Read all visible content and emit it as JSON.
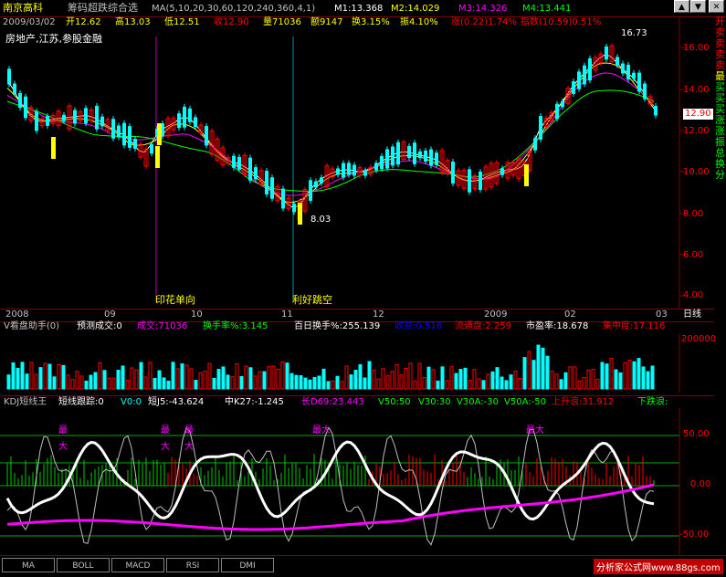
{
  "header": {
    "stock_name": "南京高科",
    "indicator_name": "筹码超跌综合选",
    "ma_params": "MA(5,10,20,30,60,120,240,360,4,1)",
    "m1": "M1:13.368",
    "m2": "M2:14.029",
    "m3": "M3:14.326",
    "m4": "M4:13.441"
  },
  "quote": {
    "date": "2009/03/02",
    "open": "开12.62",
    "high": "高13.03",
    "low": "低12.51",
    "close": "收12.90",
    "volume": "量71036",
    "amount": "额9147",
    "turnover": "换3.15%",
    "amplitude": "振4.10%",
    "change": "涨(0.22)1.74%",
    "index": "指数(10.59)0.51%"
  },
  "tags": "房地产,江苏,参股金融",
  "annotations": {
    "peak": "16.73",
    "trough": "8.03",
    "event1": "印花单向",
    "event2": "利好跳空",
    "last_price": "12.90"
  },
  "x_axis": [
    "2008",
    "09",
    "10",
    "11",
    "12",
    "2009",
    "02",
    "03"
  ],
  "x_axis_mode": "日线",
  "y_axis_main": [
    "16.00",
    "14.00",
    "12.00",
    "10.00",
    "8.00",
    "6.00",
    "4.00"
  ],
  "y_axis_vol": [
    "200000"
  ],
  "y_axis_kdj": [
    "50.00",
    "0.00",
    "-50.00"
  ],
  "sidebar_labels": [
    "开",
    "卖",
    "卖",
    "卖",
    "卖",
    "最",
    "买",
    "买",
    "买",
    "涨",
    "涨",
    "振",
    "总",
    "换",
    "分"
  ],
  "volume_panel": {
    "title": "V看盘助手(0)",
    "predict": "预测成交:0",
    "deal": "成交:71036",
    "turn": "换手率%:3.145",
    "day100": "百日换手%:255.139",
    "profit": "收益:0.516",
    "float": "流通盘:2.259",
    "pe": "市盈率:18.678",
    "conc": "集中度:17.116"
  },
  "kdj_panel": {
    "title": "KDJ短线王",
    "track": "短线跟踪:0",
    "v0": "V0:0",
    "d5": "短J5:-43.624",
    "k27": "中K27:-1.245",
    "d69": "长D69:23.443",
    "v50": "V50:50",
    "v30": "V30:30",
    "v30a": "V30A:-30",
    "v50a": "V50A:-50",
    "up": "上升浪:31.912",
    "down": "下跌浪:"
  },
  "kdj_markers": [
    "最",
    "大",
    "最",
    "大",
    "最",
    "大",
    "最大",
    "最大"
  ],
  "tabs": [
    "MA",
    "BOLL",
    "MACD",
    "RSI",
    "DMI"
  ],
  "watermark": "分析家公式网www.88gs.com",
  "colors": {
    "up": "#ff0000",
    "down": "#00ffff",
    "ma1": "#ffffff",
    "ma2": "#ffff00",
    "ma3": "#ff00ff",
    "ma4": "#00ff00"
  }
}
